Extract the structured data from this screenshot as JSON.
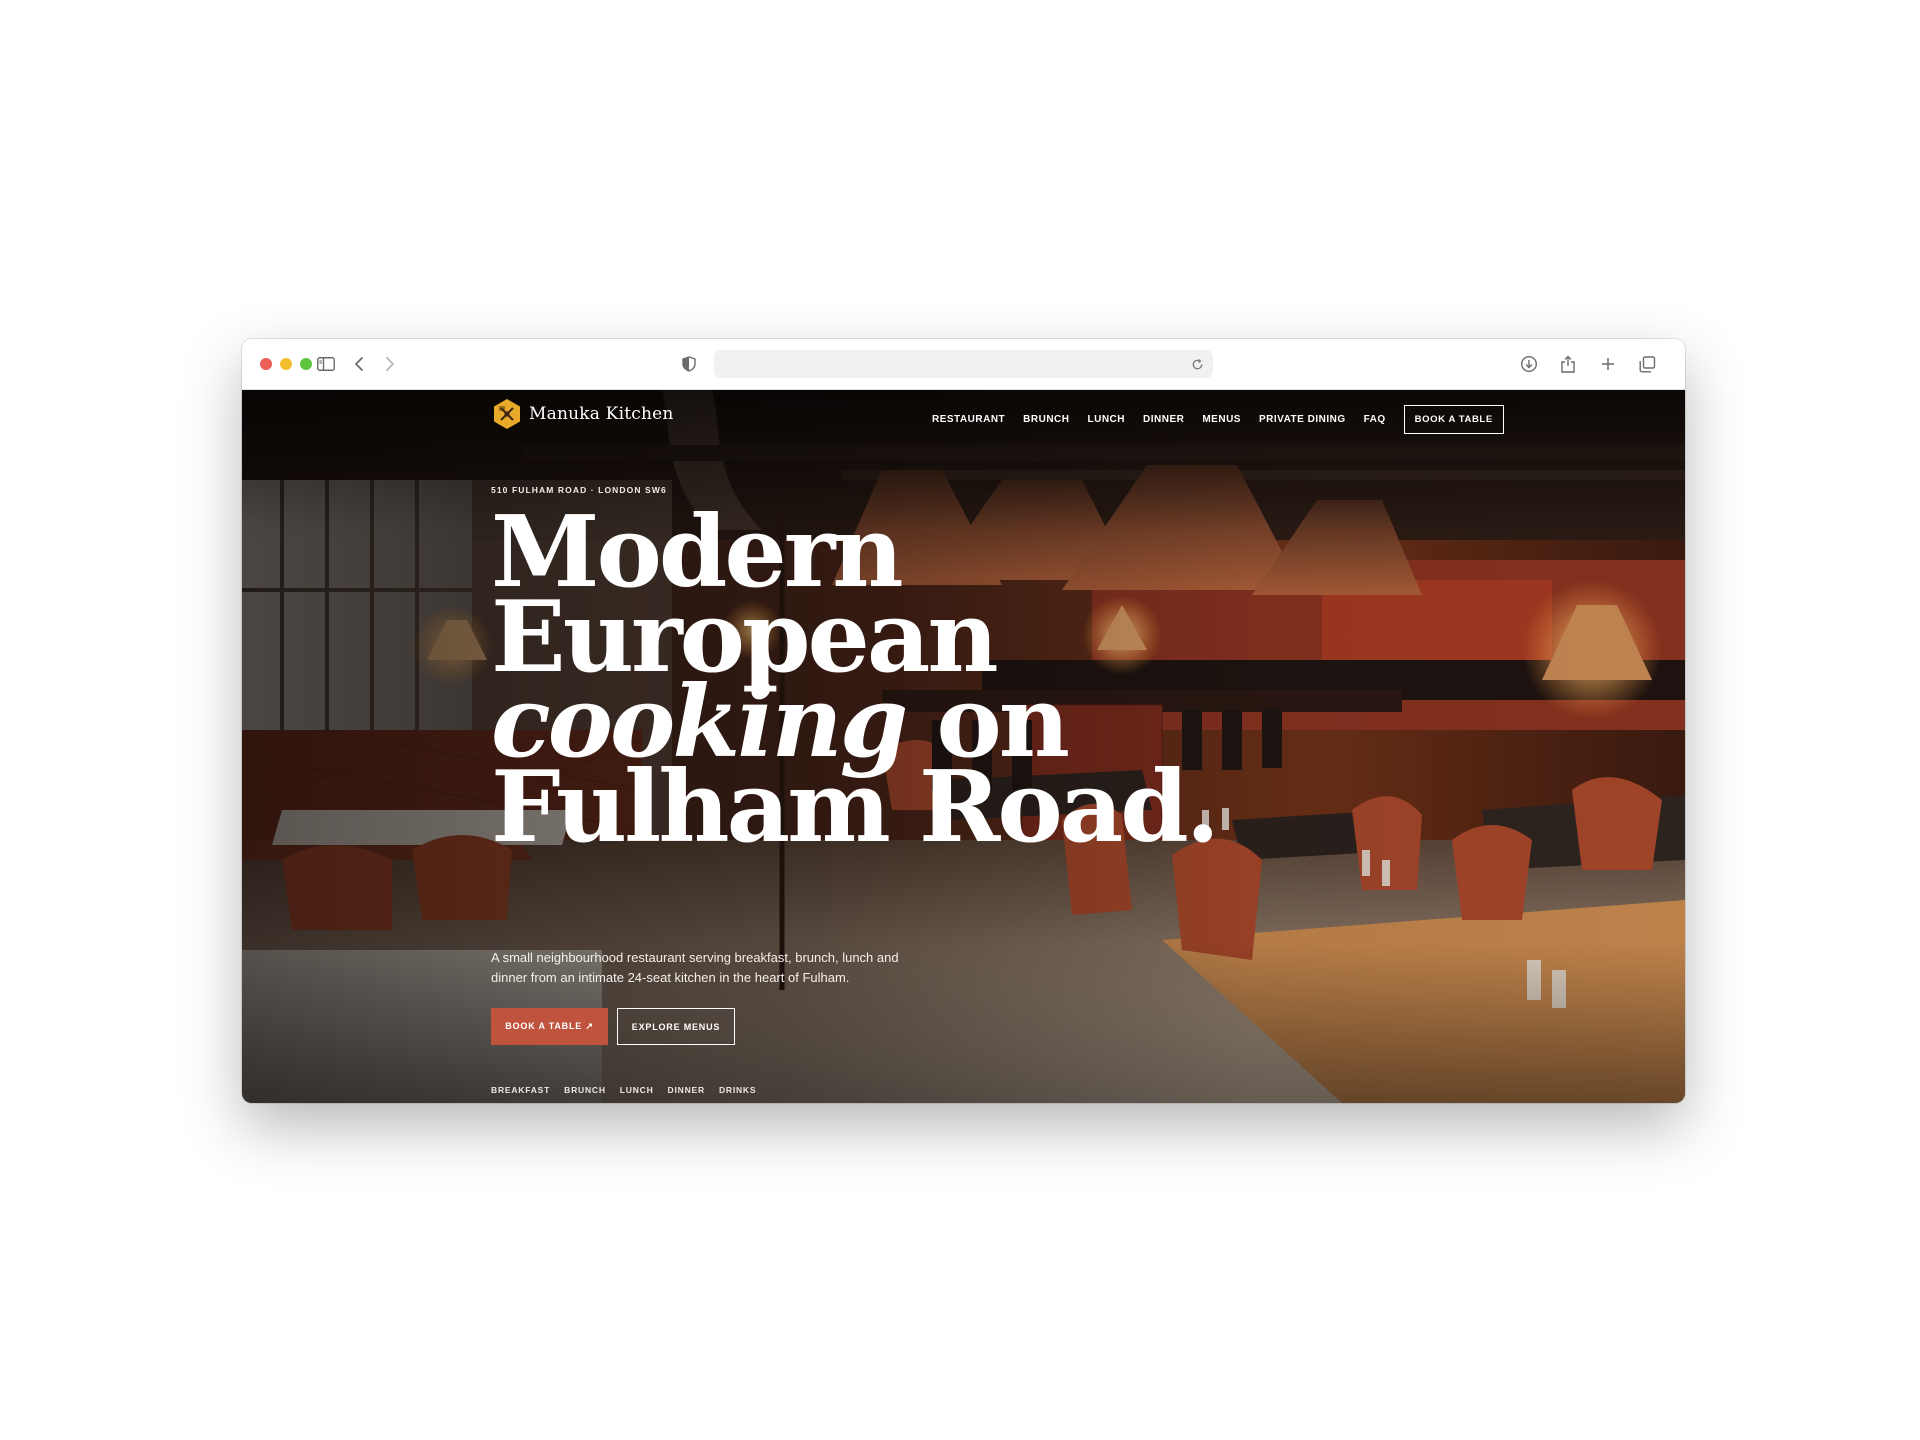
{
  "browser": {
    "url": "",
    "icons": [
      "sidebar-icon",
      "back-icon",
      "forward-icon",
      "shield-icon",
      "reload-icon",
      "download-icon",
      "share-icon",
      "new-tab-icon",
      "tabs-overview-icon"
    ]
  },
  "site": {
    "brand": "Manuka Kitchen",
    "nav": [
      "RESTAURANT",
      "BRUNCH",
      "LUNCH",
      "DINNER",
      "MENUS",
      "PRIVATE DINING",
      "FAQ"
    ],
    "nav_cta": "BOOK A TABLE",
    "eyebrow": "510 FULHAM ROAD · LONDON SW6",
    "headline": {
      "line1": "Modern",
      "line2": "European",
      "line3_italic": "cooking",
      "line3_rest": " on",
      "line4": "Fulham Road."
    },
    "subtitle": "A small neighbourhood restaurant serving breakfast, brunch, lunch and dinner from an intimate 24-seat kitchen in the heart of Fulham.",
    "primary_button": "BOOK A TABLE ↗",
    "secondary_button": "EXPLORE MENUS",
    "sub_links": [
      "BREAKFAST",
      "BRUNCH",
      "LUNCH",
      "DINNER",
      "DRINKS"
    ]
  },
  "colors": {
    "accent": "#c0533d",
    "logo_gold": "#e8a92a"
  }
}
